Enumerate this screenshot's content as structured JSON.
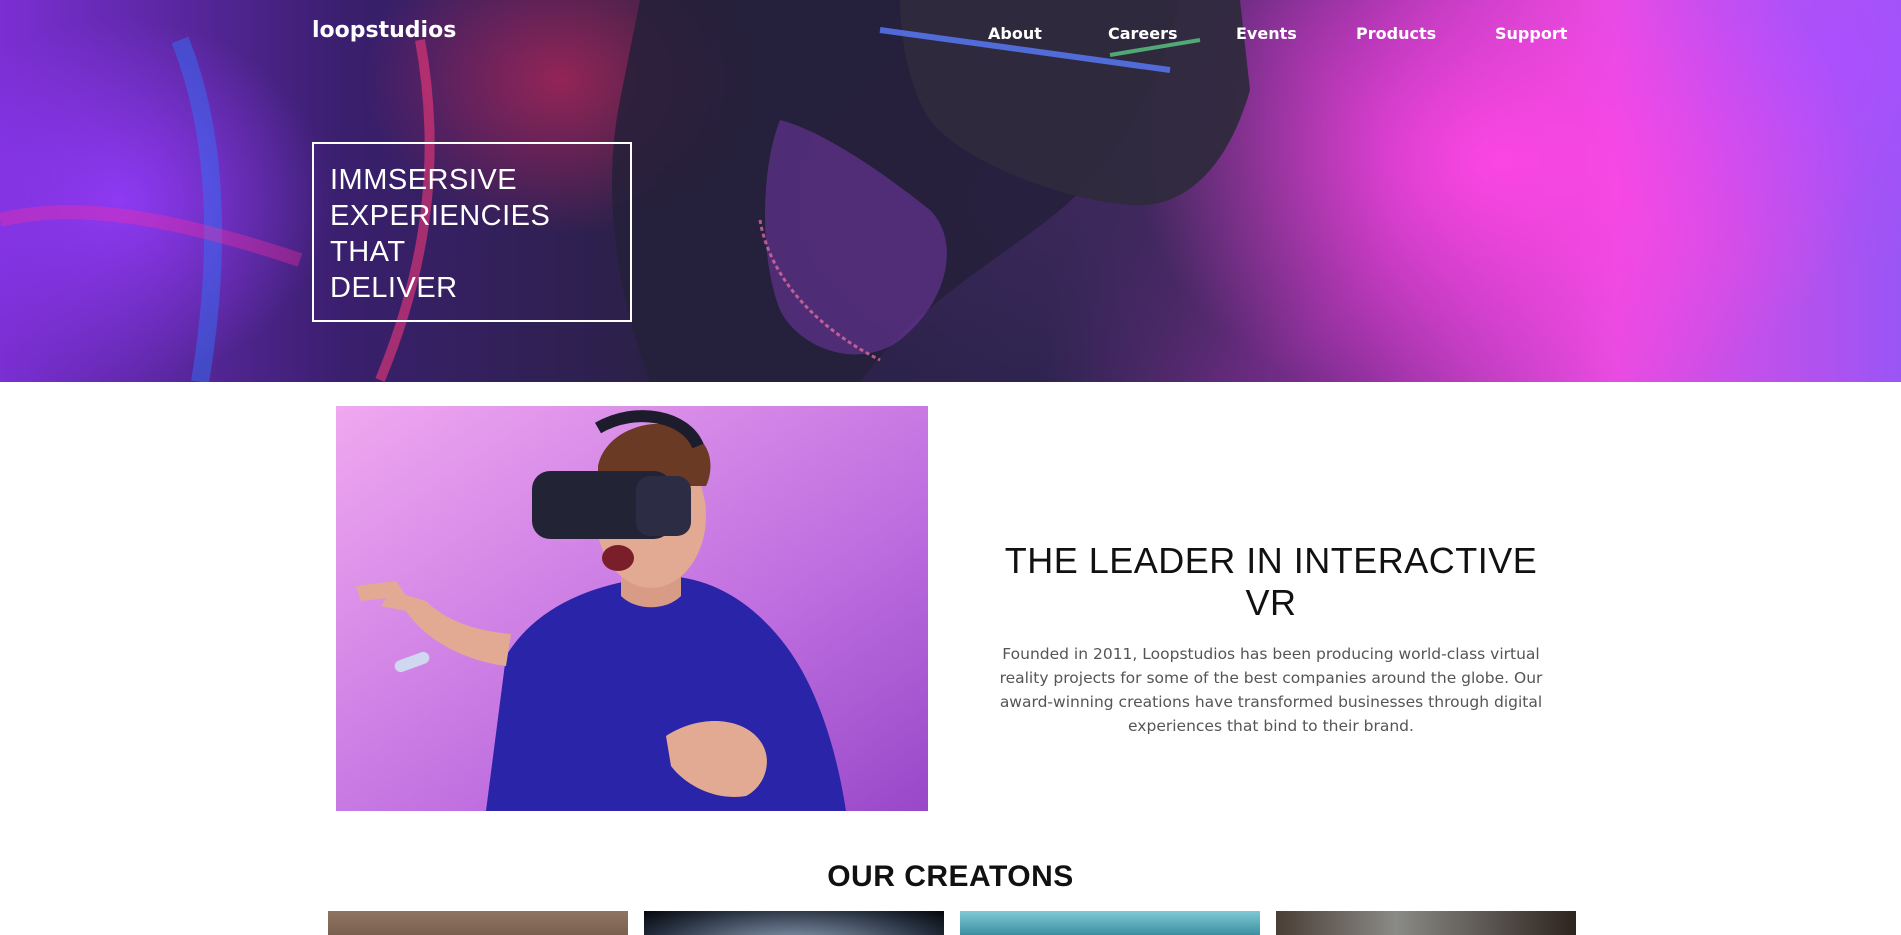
{
  "header": {
    "brand": "loopstudios",
    "nav": [
      {
        "label": "About"
      },
      {
        "label": "Careers"
      },
      {
        "label": "Events"
      },
      {
        "label": "Products"
      },
      {
        "label": "Support"
      }
    ],
    "headline_lines": [
      "IMMSERSIVE",
      "EXPERIENCIES",
      "THAT",
      "DELIVER"
    ]
  },
  "about": {
    "title": "THE LEADER IN INTERACTIVE VR",
    "body": "Founded in 2011, Loopstudios has been producing world-class virtual reality projects for some of the best companies around the globe. Our award-winning creations have transformed businesses through digital experiences that bind to their brand."
  },
  "creations": {
    "title": "OUR CREATONS"
  },
  "colors": {
    "hero_pink": "#e64ce0",
    "hero_purple": "#7b2fd4",
    "photo_bg": "#c77ce6",
    "shirt": "#2a24a8",
    "text_gray": "#555555"
  }
}
